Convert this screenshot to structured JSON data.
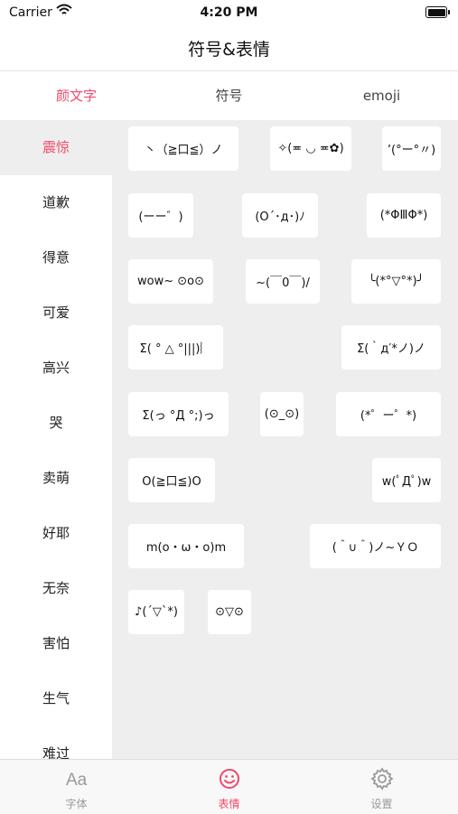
{
  "status_bar": {
    "carrier": "Carrier",
    "time": "4:20 PM"
  },
  "nav": {
    "title": "符号&表情"
  },
  "segments": [
    {
      "label": "颜文字",
      "active": true
    },
    {
      "label": "符号",
      "active": false
    },
    {
      "label": "emoji",
      "active": false
    }
  ],
  "categories": [
    {
      "label": "震惊",
      "active": true
    },
    {
      "label": "道歉"
    },
    {
      "label": "得意"
    },
    {
      "label": "可爱"
    },
    {
      "label": "高兴"
    },
    {
      "label": "哭"
    },
    {
      "label": "卖萌"
    },
    {
      "label": "好耶"
    },
    {
      "label": "无奈"
    },
    {
      "label": "害怕"
    },
    {
      "label": "生气"
    },
    {
      "label": "难过"
    }
  ],
  "emoticons": [
    "丶（≧口≦）ノ",
    "✧(≖ ◡ ≖✿)",
    "’(°ー°〃)",
    "(ーー゛)",
    "(O´･д･)ﾉ",
    "(*ΦⅢΦ*)",
    "wow~ ⊙o⊙",
    "~(￣0￣)/",
    "╰(*°▽°*)╯",
    "Σ( ° △ °|||)︴",
    "Σ(｀д′*ノ)ノ",
    "Σ(っ °Д °;)っ",
    "(⊙_⊙)",
    "(*゜ー゜*)",
    "O(≧口≦)O",
    "w(ﾟДﾟ)w",
    "m(o・ω・o)m",
    "(＾∪＾)ノ~ＹＯ",
    "♪(´▽`*)",
    "⊙▽⊙"
  ],
  "tabs": [
    {
      "label": "字体",
      "icon": "font-icon",
      "active": false
    },
    {
      "label": "表情",
      "icon": "smiley-icon",
      "active": true
    },
    {
      "label": "设置",
      "icon": "gear-icon",
      "active": false
    }
  ],
  "colors": {
    "accent": "#ef4a6b",
    "panel_bg": "#eeeeee",
    "inactive_tab": "#9a9a9a"
  }
}
